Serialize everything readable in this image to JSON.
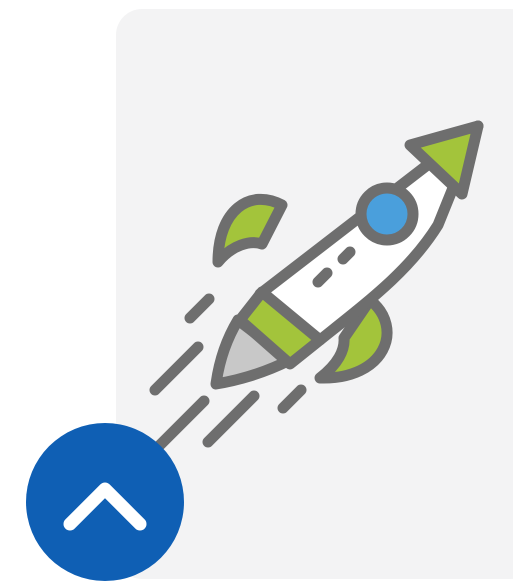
{
  "colors": {
    "card_background": "#f3f3f4",
    "outline": "#6e6e6e",
    "rocket_body": "#ffffff",
    "rocket_fins": "#a3c43b",
    "window_glass": "#4a9fdc",
    "exhaust_flame": "#c8c8c8",
    "button_background": "#0f5fb4",
    "button_icon": "#ffffff"
  },
  "illustration": {
    "icon": "rocket-icon"
  },
  "scroll_top_button": {
    "icon": "chevron-up-icon",
    "label": ""
  }
}
